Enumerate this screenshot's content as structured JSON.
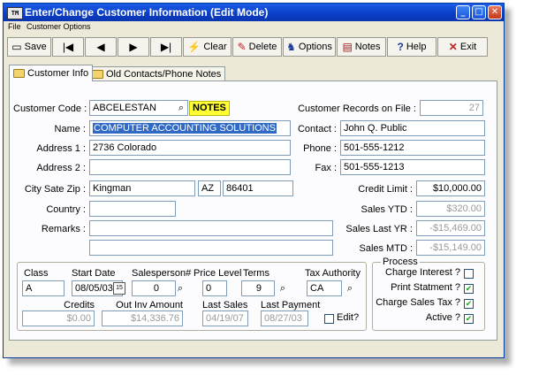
{
  "window": {
    "title": "Enter/Change Customer Information (Edit Mode)",
    "icon_text": "TM",
    "controls": [
      "_",
      "□",
      "✕"
    ]
  },
  "menu": [
    "File",
    "Customer Options"
  ],
  "toolbar": [
    {
      "label": "Save",
      "icon": "disk-icon"
    },
    {
      "label": "",
      "icon": "first-record-icon"
    },
    {
      "label": "",
      "icon": "previous-record-icon"
    },
    {
      "label": "",
      "icon": "next-record-icon"
    },
    {
      "label": "",
      "icon": "last-record-icon"
    },
    {
      "label": "Clear",
      "icon": "clear-icon"
    },
    {
      "label": "Delete",
      "icon": "delete-icon"
    },
    {
      "label": "Options",
      "icon": "options-icon"
    },
    {
      "label": "Notes",
      "icon": "notes-icon"
    },
    {
      "label": "Help",
      "icon": "help-icon"
    },
    {
      "label": "Exit",
      "icon": "exit-icon"
    }
  ],
  "tabs": [
    "Customer Info",
    "Old Contacts/Phone Notes"
  ],
  "form": {
    "customer_code_label": "Customer Code :",
    "customer_code": "ABCELESTAN",
    "notes_badge": "NOTES",
    "name_label": "Name :",
    "name": "COMPUTER ACCOUNTING SOLUTIONS",
    "address1_label": "Address 1 :",
    "address1": "2736 Colorado",
    "address2_label": "Address 2 :",
    "address2": "",
    "csz_label": "City Sate Zip :",
    "city": "Kingman",
    "state": "AZ",
    "zip": "86401",
    "country_label": "Country :",
    "country": "",
    "remarks_label": "Remarks :",
    "remarks1": "",
    "remarks2": "",
    "records_label": "Customer Records on File :",
    "records_count": "27",
    "contact_label": "Contact :",
    "contact": "John Q. Public",
    "phone_label": "Phone :",
    "phone": "501-555-1212",
    "fax_label": "Fax :",
    "fax": "501-555-1213",
    "credit_limit_label": "Credit Limit :",
    "credit_limit": "$10,000.00",
    "sales_ytd_label": "Sales YTD :",
    "sales_ytd": "$320.00",
    "sales_last_yr_label": "Sales Last YR :",
    "sales_last_yr": "-$15,469.00",
    "sales_mtd_label": "Sales MTD :",
    "sales_mtd": "-$15,149.00"
  },
  "bottom": {
    "class_label": "Class",
    "class": "A",
    "start_date_label": "Start Date",
    "start_date": "08/05/03",
    "salesperson_label": "Salesperson#",
    "salesperson": "0",
    "price_level_label": "Price Level",
    "price_level": "0",
    "terms_label": "Terms",
    "terms": "9",
    "tax_authority_label": "Tax Authority",
    "tax_authority": "CA",
    "credits_label": "Credits",
    "credits": "$0.00",
    "out_inv_label": "Out Inv Amount",
    "out_inv": "$14,336.76",
    "last_sales_label": "Last Sales",
    "last_sales": "04/19/07",
    "last_payment_label": "Last Payment",
    "last_payment": "08/27/03",
    "edit_label": "Edit?"
  },
  "process": {
    "title": "Process",
    "items": [
      {
        "label": "Charge Interest ?",
        "checked": false
      },
      {
        "label": "Print Statment ?",
        "checked": true
      },
      {
        "label": "Charge Sales Tax ?",
        "checked": true
      },
      {
        "label": "Active ?",
        "checked": true
      }
    ]
  }
}
